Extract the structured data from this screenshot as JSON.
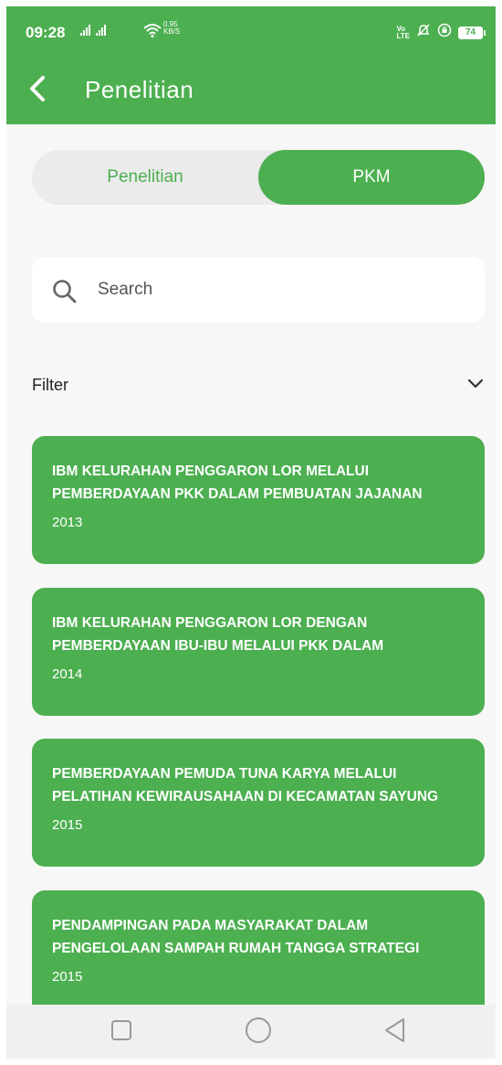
{
  "status_bar": {
    "time": "09:28",
    "net_speed_value": "0.95",
    "net_speed_unit": "KB/S",
    "volte_top": "Vo",
    "volte_bottom": "LTE",
    "battery": "74"
  },
  "app_bar": {
    "title": "Penelitian",
    "back_icon": "chevron-left-icon"
  },
  "tabs": [
    {
      "label": "Penelitian",
      "selected": false
    },
    {
      "label": "PKM",
      "selected": true
    }
  ],
  "search": {
    "placeholder": "Search",
    "value": "",
    "icon": "search-icon"
  },
  "filter": {
    "label": "Filter",
    "icon": "chevron-down-icon"
  },
  "items": [
    {
      "title": "IBM KELURAHAN PENGGARON LOR MELALUI PEMBERDAYAAN PKK DALAM PEMBUATAN JAJANAN",
      "year": "2013"
    },
    {
      "title": "IBM KELURAHAN PENGGARON LOR DENGAN PEMBERDAYAAN IBU-IBU MELALUI PKK DALAM",
      "year": "2014"
    },
    {
      "title": "PEMBERDAYAAN  PEMUDA  TUNA KARYA MELALUI PELATIHAN  KEWIRAUSAHAAN DI KECAMATAN SAYUNG",
      "year": "2015"
    },
    {
      "title": "PENDAMPINGAN PADA MASYARAKAT DALAM PENGELOLAAN SAMPAH RUMAH TANGGA STRATEGI",
      "year": "2015"
    }
  ],
  "nav_bar": {
    "recents_icon": "square-icon",
    "home_icon": "circle-icon",
    "back_icon": "triangle-back-icon"
  },
  "colors": {
    "primary": "#4caf50",
    "background": "#f7f7f7",
    "segment_bg": "#ebebeb"
  }
}
